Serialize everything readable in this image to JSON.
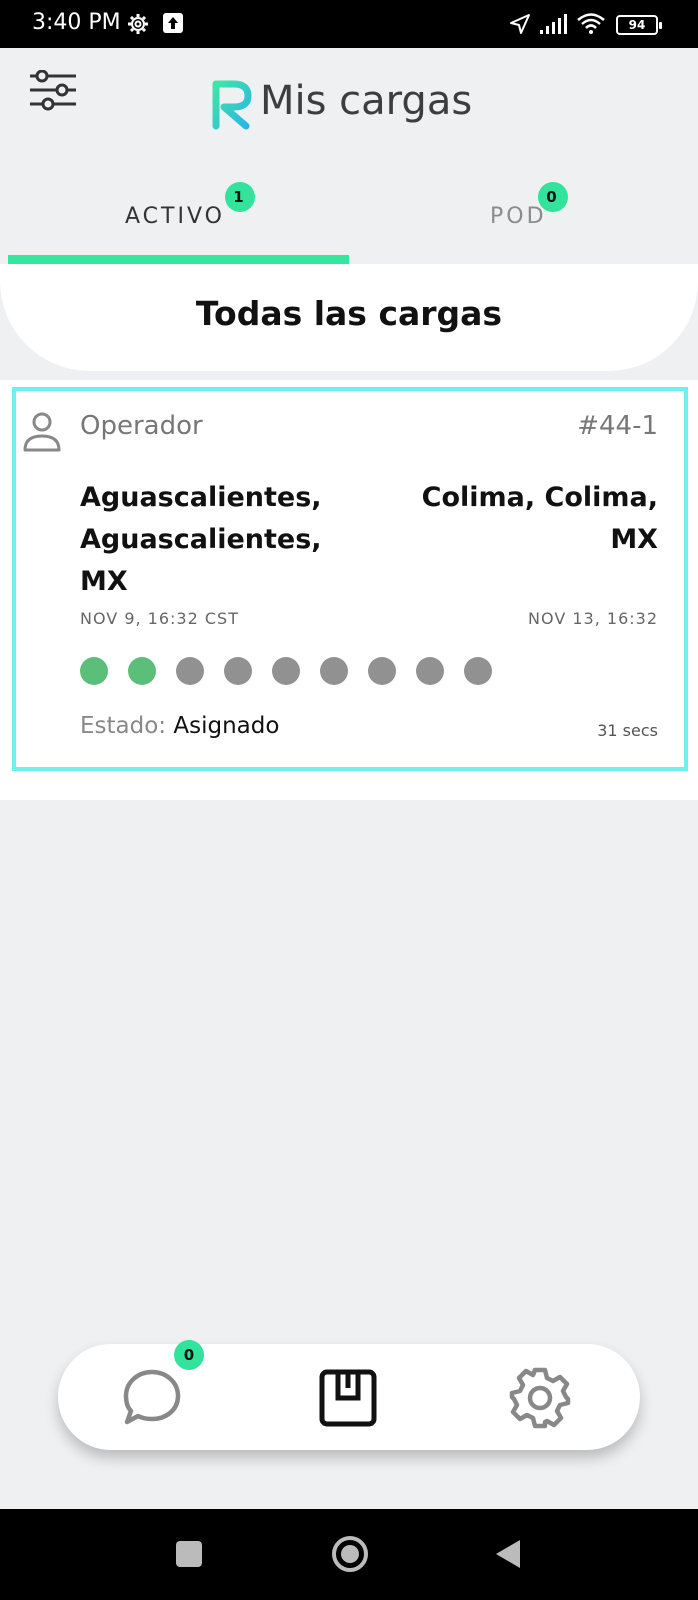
{
  "status_bar": {
    "time": "3:40 PM",
    "battery": "94"
  },
  "header": {
    "title": "Mis cargas"
  },
  "tabs": [
    {
      "label": "ACTIVO",
      "count": "1"
    },
    {
      "label": "POD",
      "count": "0"
    }
  ],
  "section": {
    "title": "Todas las cargas"
  },
  "load": {
    "role": "Operador",
    "id": "#44-1",
    "origin": "Aguascalientes, Aguascalientes, MX",
    "destination": "Colima, Colima, MX",
    "origin_date": "NOV 9, 16:32 CST",
    "destination_date": "NOV 13, 16:32",
    "progress_completed": 2,
    "progress_total": 9,
    "state_label": "Estado:",
    "state_value": "Asignado",
    "elapsed": "31 secs"
  },
  "bottom_nav": {
    "chat_count": "0"
  },
  "colors": {
    "accent": "#33e79c",
    "card_border": "#6ef0ef",
    "step_done": "#5bbf7a",
    "step_pending": "#919191"
  }
}
